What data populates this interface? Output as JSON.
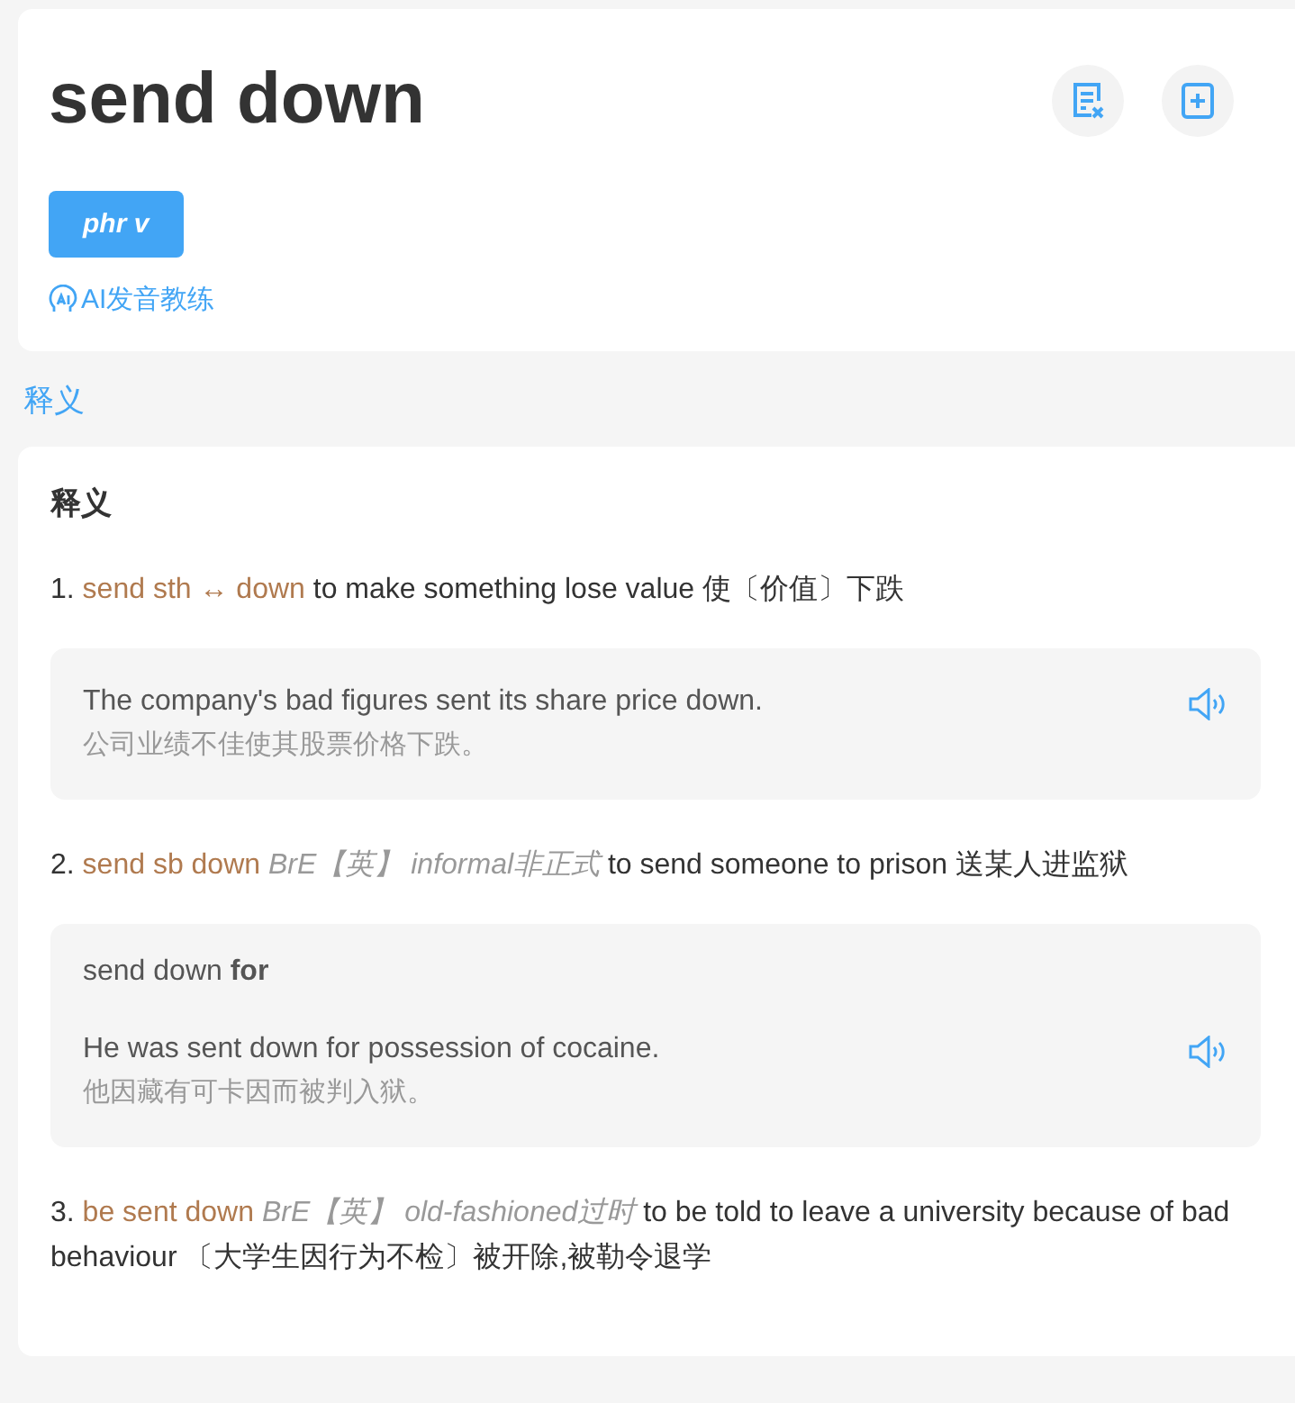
{
  "headword": "send down",
  "part_of_speech": "phr v",
  "ai_coach": "AI发音教练",
  "section_link": "释义",
  "definitions": {
    "title": "释义",
    "senses": [
      {
        "number": "1.",
        "phrase": "send sth ↔ down",
        "definition": "to make something lose value 使〔价值〕下跌",
        "examples": [
          {
            "en": "The company's bad figures sent its share price down.",
            "zh": "公司业绩不佳使其股票价格下跌。"
          }
        ]
      },
      {
        "number": "2.",
        "phrase": "send sb down",
        "labels": [
          "BrE【英】",
          "informal非正式"
        ],
        "definition": "to send someone to prison 送某人进监狱",
        "examples": [
          {
            "pattern": "send down **for**",
            "en": "He was sent down for possession of cocaine.",
            "zh": "他因藏有可卡因而被判入狱。"
          }
        ]
      },
      {
        "number": "3.",
        "phrase": "be sent down",
        "labels": [
          "BrE【英】",
          "old-fashioned过时"
        ],
        "definition": "to be told to leave a university because of bad behaviour 〔大学生因行为不检〕被开除,被勒令退学"
      }
    ]
  }
}
